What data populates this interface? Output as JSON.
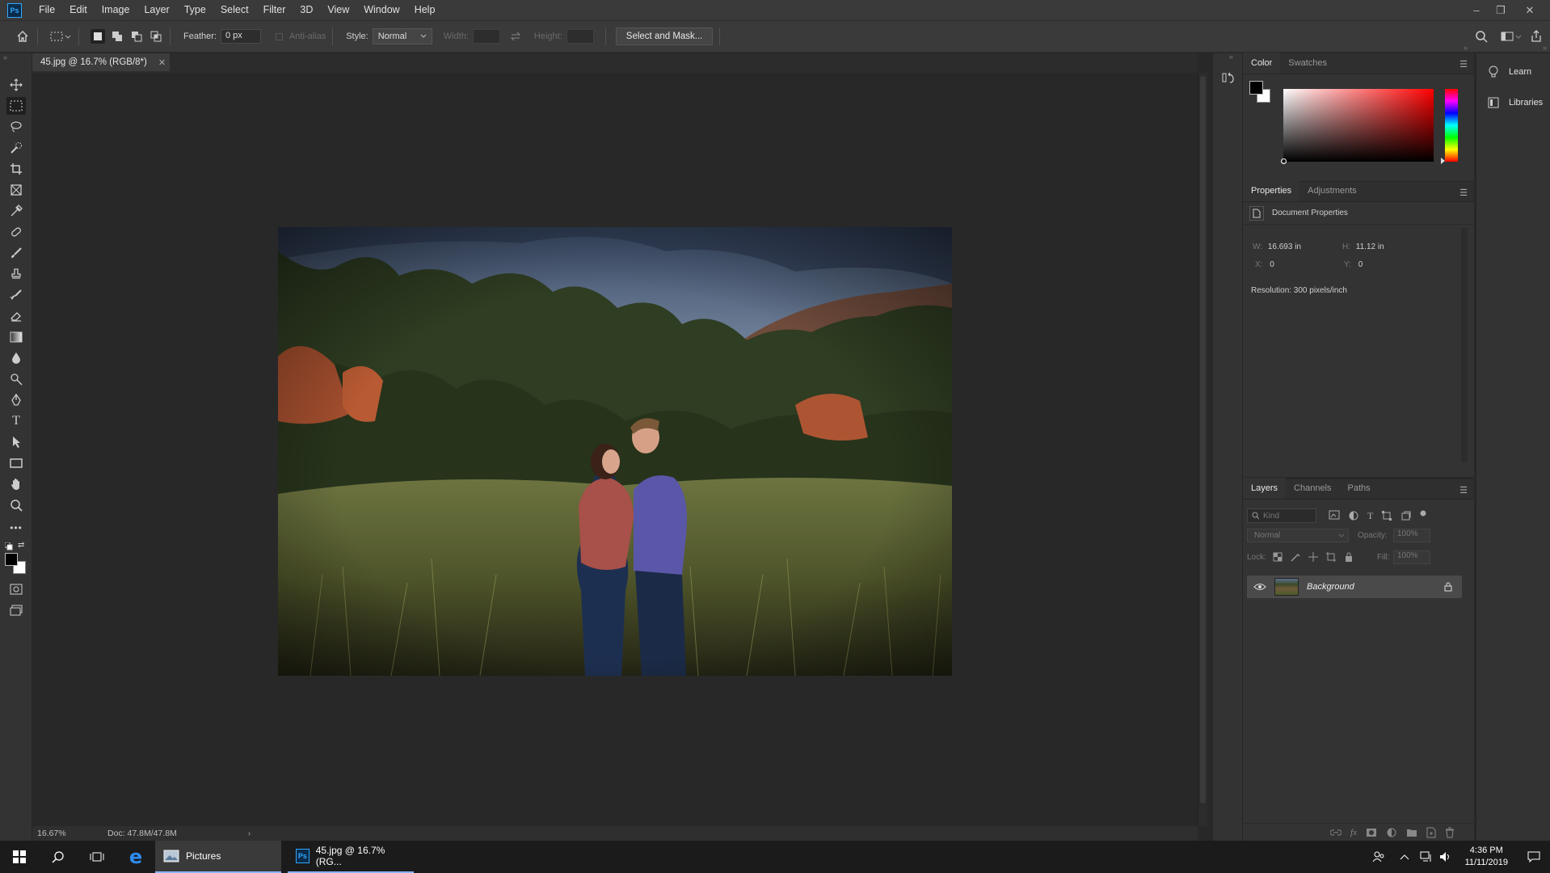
{
  "app": {
    "logo": "Ps",
    "document_tab_title": "45.jpg @ 16.7% (RGB/8*)"
  },
  "menu": [
    "File",
    "Edit",
    "Image",
    "Layer",
    "Type",
    "Select",
    "Filter",
    "3D",
    "View",
    "Window",
    "Help"
  ],
  "window_controls": {
    "minimize": "–",
    "restore": "❐",
    "close": "✕"
  },
  "options_bar": {
    "feather_label": "Feather:",
    "feather_value": "0 px",
    "anti_alias_label": "Anti-alias",
    "style_label": "Style:",
    "style_value": "Normal",
    "width_label": "Width:",
    "height_label": "Height:",
    "select_mask_label": "Select and Mask..."
  },
  "status_bar": {
    "zoom": "16.67%",
    "doc_size": "Doc: 47.8M/47.8M",
    "arrow": "›"
  },
  "color_panel": {
    "tabs": [
      "Color",
      "Swatches"
    ],
    "active_tab": "Color",
    "foreground": "#000000",
    "background": "#ffffff",
    "hue_color": "#ff0000"
  },
  "properties_panel": {
    "tabs": [
      "Properties",
      "Adjustments"
    ],
    "active_tab": "Properties",
    "section_title": "Document Properties",
    "w_label": "W:",
    "w_value": "16.693 in",
    "h_label": "H:",
    "h_value": "11.12 in",
    "x_label": "X:",
    "x_value": "0",
    "y_label": "Y:",
    "y_value": "0",
    "resolution": "Resolution: 300 pixels/inch"
  },
  "layers_panel": {
    "tabs": [
      "Layers",
      "Channels",
      "Paths"
    ],
    "active_tab": "Layers",
    "filter_placeholder": "Kind",
    "blend_mode": "Normal",
    "opacity_label": "Opacity:",
    "opacity_value": "100%",
    "lock_label": "Lock:",
    "fill_label": "Fill:",
    "fill_value": "100%",
    "layers": [
      {
        "name": "Background",
        "visible": true,
        "locked": true
      }
    ]
  },
  "side_buttons": {
    "learn": "Learn",
    "libraries": "Libraries"
  },
  "taskbar": {
    "apps": [
      {
        "label": "Pictures",
        "active": true
      },
      {
        "label": "45.jpg @ 16.7% (RG...",
        "active": false,
        "icon": "Ps"
      }
    ],
    "time": "4:36 PM",
    "date": "11/11/2019"
  }
}
